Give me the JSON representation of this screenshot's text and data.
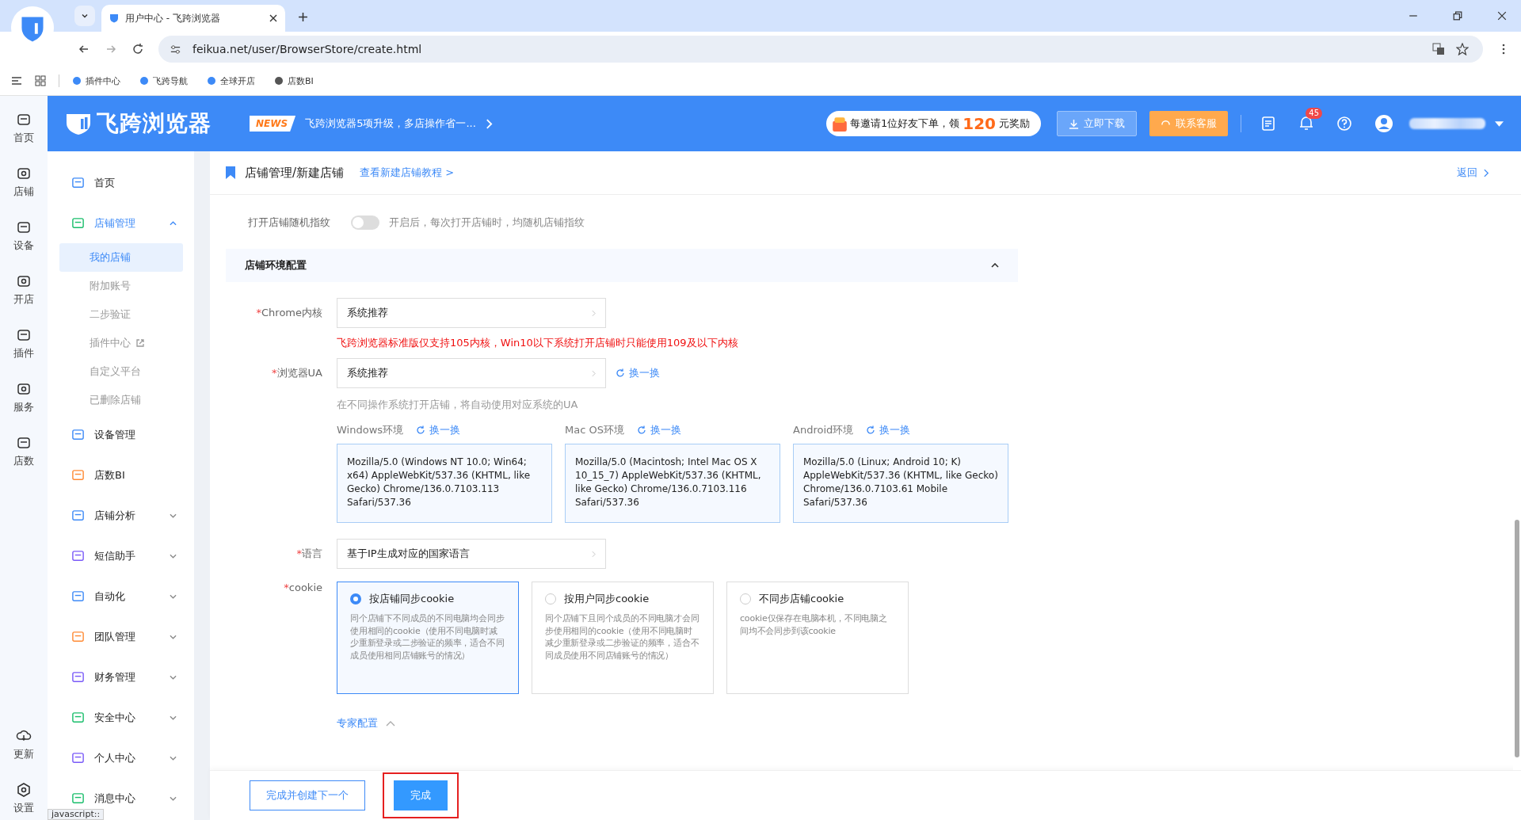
{
  "browser": {
    "tab_title": "用户中心 - 飞跨浏览器",
    "url": "feikua.net/user/BrowserStore/create.html",
    "bookmarks": [
      "插件中心",
      "飞跨导航",
      "全球开店",
      "店数BI"
    ],
    "status_text": "javascript::"
  },
  "header": {
    "logo": "飞跨浏览器",
    "news_badge": "NEWS",
    "news_text": "飞跨浏览器5项升级，多店操作省一...",
    "invite_prefix": "每邀请1位好友下单，领",
    "invite_amount": "120",
    "invite_suffix": "元奖励",
    "download": "立即下载",
    "support": "联系客服",
    "notifications": "45"
  },
  "rail": [
    {
      "label": "首页"
    },
    {
      "label": "店铺"
    },
    {
      "label": "设备"
    },
    {
      "label": "开店"
    },
    {
      "label": "插件"
    },
    {
      "label": "服务"
    },
    {
      "label": "店数"
    }
  ],
  "rail_bottom": [
    {
      "label": "更新"
    },
    {
      "label": "设置"
    }
  ],
  "menu": [
    {
      "label": "首页",
      "selected": false
    },
    {
      "label": "店铺管理",
      "selected": true,
      "expanded": true,
      "children": [
        {
          "label": "我的店铺",
          "selected": true,
          "external": false
        },
        {
          "label": "附加账号",
          "selected": false,
          "external": false
        },
        {
          "label": "二步验证",
          "selected": false,
          "external": false
        },
        {
          "label": "插件中心",
          "selected": false,
          "external": true
        },
        {
          "label": "自定义平台",
          "selected": false,
          "external": false
        },
        {
          "label": "已删除店铺",
          "selected": false,
          "external": false
        }
      ]
    },
    {
      "label": "设备管理",
      "selected": false
    },
    {
      "label": "店数BI",
      "selected": false
    },
    {
      "label": "店铺分析",
      "selected": false,
      "expanded": false
    },
    {
      "label": "短信助手",
      "selected": false,
      "expanded": false
    },
    {
      "label": "自动化",
      "selected": false,
      "expanded": false
    },
    {
      "label": "团队管理",
      "selected": false,
      "expanded": false
    },
    {
      "label": "财务管理",
      "selected": false,
      "expanded": false
    },
    {
      "label": "安全中心",
      "selected": false,
      "expanded": false
    },
    {
      "label": "个人中心",
      "selected": false,
      "expanded": false
    },
    {
      "label": "消息中心",
      "selected": false,
      "expanded": false
    }
  ],
  "page": {
    "breadcrumb": "店铺管理/新建店铺",
    "tutorial_link": "查看新建店铺教程 >",
    "back": "返回"
  },
  "fingerprint": {
    "label": "打开店铺随机指纹",
    "on": false,
    "hint": "开启后，每次打开店铺时，均随机店铺指纹"
  },
  "section": {
    "title": "店铺环境配置",
    "expanded": true
  },
  "chrome_kernel": {
    "mark": "*",
    "label": "Chrome内核",
    "value": "系统推荐",
    "warning": "飞跨浏览器标准版仅支持105内核，Win10以下系统打开店铺时只能使用109及以下内核"
  },
  "browser_ua": {
    "mark": "*",
    "label": "浏览器UA",
    "value": "系统推荐",
    "refresh": "换一换",
    "hint": "在不同操作系统打开店铺，将自动使用对应系统的UA"
  },
  "ua_envs": [
    {
      "label": "Windows环境",
      "refresh": "换一换",
      "ua": "Mozilla/5.0 (Windows NT 10.0; Win64; x64) AppleWebKit/537.36 (KHTML, like Gecko) Chrome/136.0.7103.113 Safari/537.36"
    },
    {
      "label": "Mac OS环境",
      "refresh": "换一换",
      "ua": "Mozilla/5.0 (Macintosh; Intel Mac OS X 10_15_7) AppleWebKit/537.36 (KHTML, like Gecko) Chrome/136.0.7103.116 Safari/537.36"
    },
    {
      "label": "Android环境",
      "refresh": "换一换",
      "ua": "Mozilla/5.0 (Linux; Android 10; K) AppleWebKit/537.36 (KHTML, like Gecko) Chrome/136.0.7103.61 Mobile Safari/537.36"
    }
  ],
  "language": {
    "mark": "*",
    "label": "语言",
    "value": "基于IP生成对应的国家语言"
  },
  "cookie": {
    "mark": "*",
    "label": "cookie",
    "options": [
      {
        "title": "按店铺同步cookie",
        "selected": true,
        "description": "同个店铺下不同成员的不同电脑均会同步使用相同的cookie（使用不同电脑时减少重新登录或二步验证的频率，适合不同成员使用相同店铺账号的情况）"
      },
      {
        "title": "按用户同步cookie",
        "selected": false,
        "description": "同个店铺下且同个成员的不同电脑才会同步使用相同的cookie（使用不同电脑时减少重新登录或二步验证的频率，适合不同成员使用不同店铺账号的情况）"
      },
      {
        "title": "不同步店铺cookie",
        "selected": false,
        "description": "cookie仅保存在电脑本机，不同电脑之间均不会同步到该cookie"
      }
    ]
  },
  "expert": {
    "label": "专家配置",
    "expanded": true
  },
  "footer": {
    "next_button": "完成并创建下一个",
    "done_button": "完成",
    "done_highlighted": true
  }
}
